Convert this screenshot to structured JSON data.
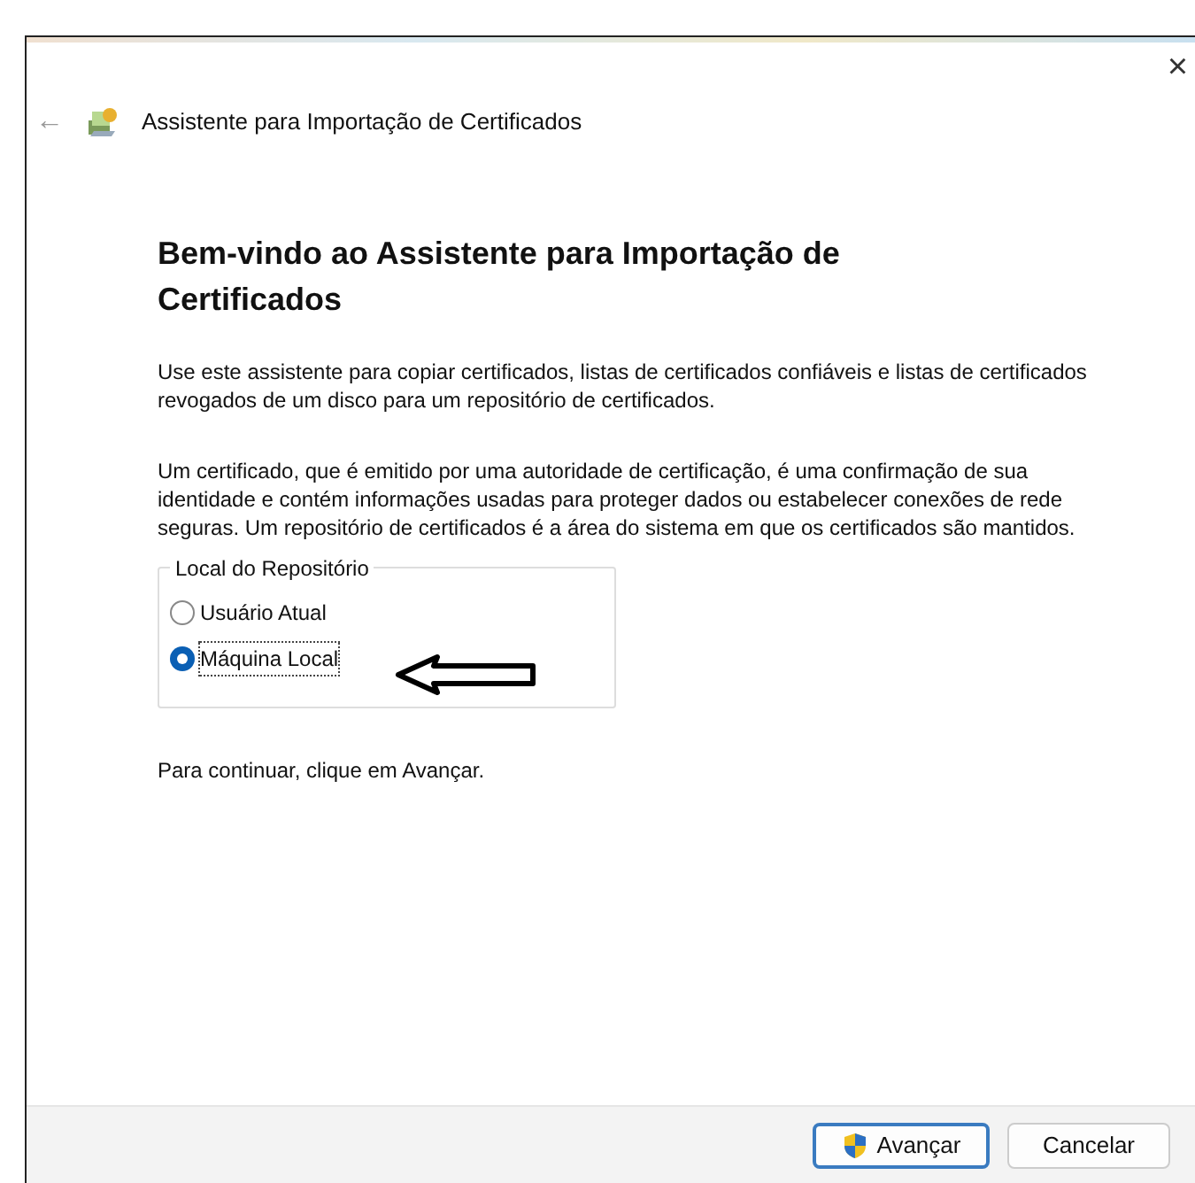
{
  "window": {
    "title": "Assistente para Importação de Certificados",
    "close": "×",
    "back": "←"
  },
  "heading": "Bem-vindo ao Assistente para Importação de Certificados",
  "paragraphs": [
    "Use este assistente para copiar certificados, listas de certificados confiáveis e listas de certificados revogados de um disco para um repositório de certificados.",
    "Um certificado, que é emitido por uma autoridade de certificação, é uma confirmação de sua identidade e contém informações usadas para proteger dados ou estabelecer conexões de rede seguras. Um repositório de certificados é a área do sistema em que os certificados são mantidos."
  ],
  "store_location": {
    "label": "Local do Repositório",
    "options": [
      {
        "label": "Usuário Atual",
        "selected": false
      },
      {
        "label": "Máquina Local",
        "selected": true
      }
    ]
  },
  "hint": "Para continuar, clique em Avançar.",
  "buttons": [
    {
      "label": "Avançar",
      "kind": "shield"
    },
    {
      "label": "Cancelar",
      "kind": "plain"
    }
  ]
}
